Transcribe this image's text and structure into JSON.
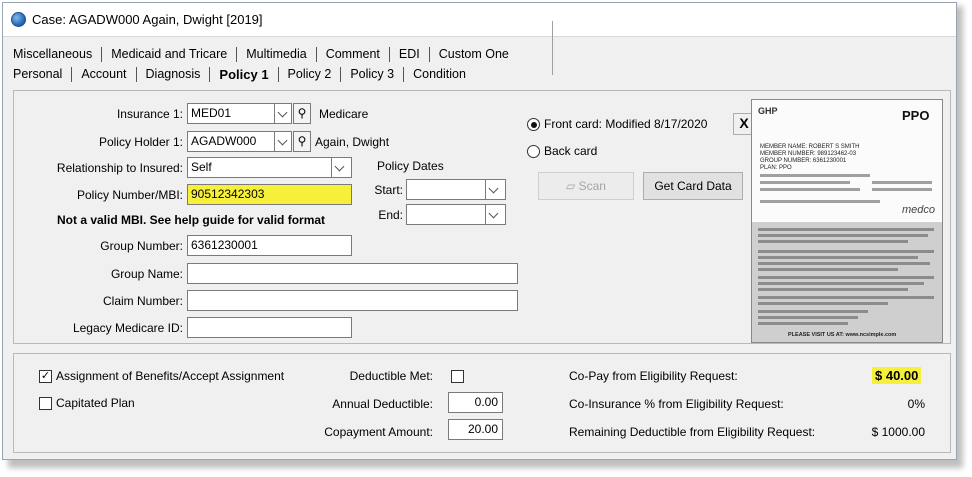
{
  "window": {
    "title": "Case: AGADW000 Again, Dwight  [2019]"
  },
  "tabs": {
    "row1": [
      "Miscellaneous",
      "Medicaid and Tricare",
      "Multimedia",
      "Comment",
      "EDI",
      "Custom One"
    ],
    "row2": [
      "Personal",
      "Account",
      "Diagnosis",
      "Policy 1",
      "Policy 2",
      "Policy 3",
      "Condition"
    ],
    "active": "Policy 1"
  },
  "policy": {
    "insurance_label": "Insurance 1:",
    "insurance_code": "MED01",
    "insurance_name": "Medicare",
    "holder_label": "Policy Holder 1:",
    "holder_code": "AGADW000",
    "holder_name": "Again, Dwight",
    "relationship_label": "Relationship to Insured:",
    "relationship_value": "Self",
    "policy_number_label": "Policy Number/MBI:",
    "policy_number_value": "90512342303",
    "mbi_warning": "Not a valid MBI. See help guide for valid format",
    "policy_dates_label": "Policy Dates",
    "start_label": "Start:",
    "end_label": "End:",
    "group_number_label": "Group Number:",
    "group_number_value": "6361230001",
    "group_name_label": "Group Name:",
    "group_name_value": "",
    "claim_number_label": "Claim Number:",
    "claim_number_value": "",
    "legacy_medicare_label": "Legacy Medicare ID:",
    "legacy_medicare_value": ""
  },
  "card_panel": {
    "front_card_label": "Front card: Modified 8/17/2020",
    "back_card_label": "Back card",
    "selected": "front",
    "close_label": "X",
    "scan_label": "Scan",
    "get_card_data_label": "Get Card Data"
  },
  "card_image": {
    "brand": "GHP",
    "plan_type": "PPO",
    "member_name": "MEMBER NAME: ROBERT S SMITH",
    "member_number": "MEMBER NUMBER: 989123462-03",
    "group_number": "GROUP NUMBER: 6361230001",
    "plan": "PLAN: PPO",
    "footer": "PLEASE VISIT US AT: www.ncsimple.com",
    "partner": "medco"
  },
  "bottom": {
    "assignment_label": "Assignment of Benefits/Accept Assignment",
    "assignment_checked": true,
    "capitated_label": "Capitated Plan",
    "capitated_checked": false,
    "deductible_met_label": "Deductible Met:",
    "deductible_met_checked": false,
    "annual_deductible_label": "Annual Deductible:",
    "annual_deductible_value": "0.00",
    "copayment_label": "Copayment Amount:",
    "copayment_value": "20.00",
    "copay_eligibility_label": "Co-Pay from Eligibility Request:",
    "copay_eligibility_value": "$ 40.00",
    "coinsurance_label": "Co-Insurance % from Eligibility Request:",
    "coinsurance_value": "0%",
    "remaining_deductible_label": "Remaining Deductible from Eligibility Request:",
    "remaining_deductible_value": "$ 1000.00"
  }
}
